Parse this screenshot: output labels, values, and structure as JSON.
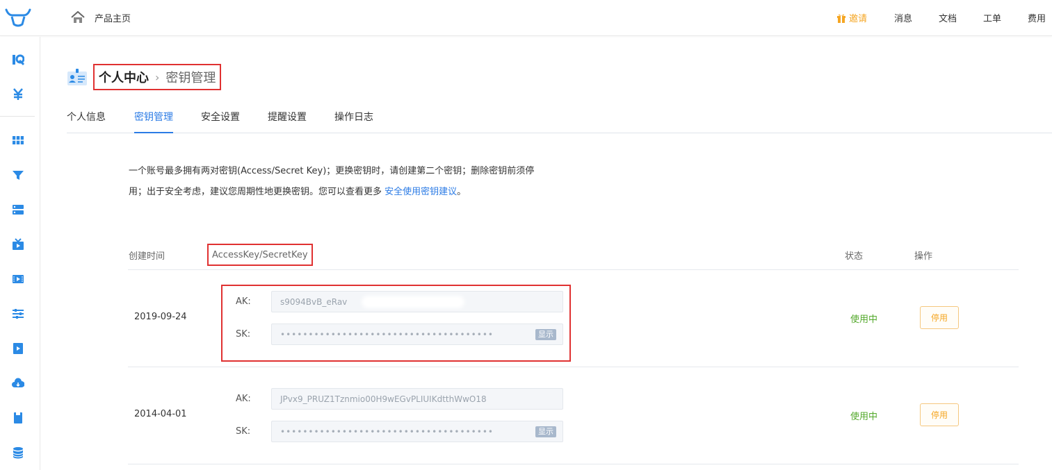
{
  "topbar": {
    "home_label": "产品主页",
    "invite_label": "邀请",
    "messages_label": "消息",
    "docs_label": "文档",
    "tickets_label": "工单",
    "billing_label": "费用"
  },
  "page": {
    "title": "个人中心",
    "current": "密钥管理"
  },
  "tabs": [
    {
      "label": "个人信息"
    },
    {
      "label": "密钥管理",
      "active": true
    },
    {
      "label": "安全设置"
    },
    {
      "label": "提醒设置"
    },
    {
      "label": "操作日志"
    }
  ],
  "description": {
    "line1": "一个账号最多拥有两对密钥(Access/Secret Key)；更换密钥时，请创建第二个密钥；删除密钥前须停",
    "line2_prefix": "用；出于安全考虑，建议您周期性地更换密钥。您可以查看更多 ",
    "link": "安全使用密钥建议",
    "line2_suffix": "。"
  },
  "table": {
    "col_created": "创建时间",
    "col_keys": "AccessKey/SecretKey",
    "col_status": "状态",
    "col_action": "操作",
    "rows": [
      {
        "date": "2019-09-24",
        "ak_label": "AK:",
        "ak_value": "s9094BvB_eRav",
        "sk_label": "SK:",
        "sk_value": "••••••••••••••••••••••••••••••••••••••",
        "reveal_label": "显示",
        "status": "使用中",
        "action": "停用"
      },
      {
        "date": "2014-04-01",
        "ak_label": "AK:",
        "ak_value": "JPvx9_PRUZ1Tznmio00H9wEGvPLIUIKdtthWwO18",
        "sk_label": "SK:",
        "sk_value": "••••••••••••••••••••••••••••••••••••••",
        "reveal_label": "显示",
        "status": "使用中",
        "action": "停用"
      }
    ]
  },
  "colors": {
    "accent": "#2b7be5",
    "annotation": "#e03131",
    "status_active": "#52a82a",
    "warning": "#f5a623"
  },
  "icons": {
    "logo": "bull-head-logo-icon",
    "home": "home-icon",
    "invite": "gift-icon",
    "page": "id-card-icon"
  }
}
